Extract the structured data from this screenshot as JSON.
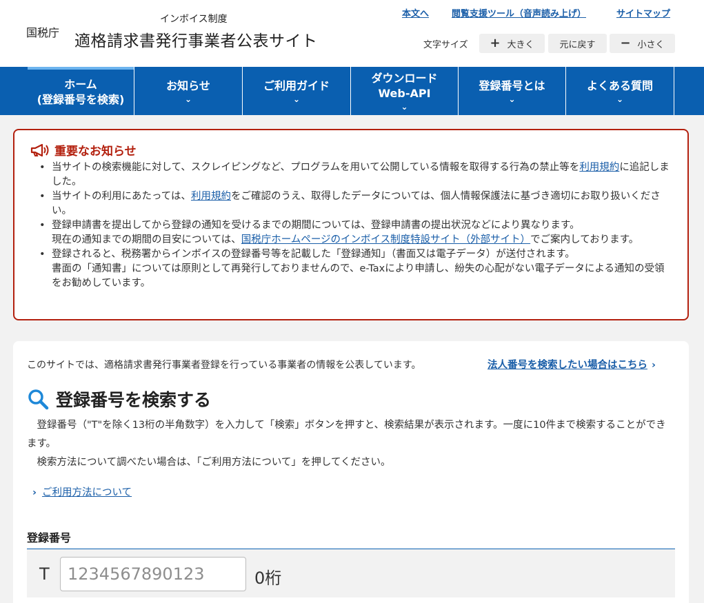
{
  "header": {
    "agency": "国税庁",
    "subtitle": "インボイス制度",
    "title": "適格請求書発行事業者公表サイト",
    "links": [
      "本文へ",
      "閲覧支援ツール（音声読み上げ）",
      "サイトマップ"
    ],
    "font_size_label": "文字サイズ",
    "font_buttons": [
      {
        "symbol": "+",
        "label": "大きく"
      },
      {
        "symbol": "",
        "label": "元に戻す"
      },
      {
        "symbol": "−",
        "label": "小さく"
      }
    ]
  },
  "nav": {
    "items": [
      {
        "line1": "ホーム",
        "line2": "(登録番号を検索)",
        "chevron": ""
      },
      {
        "line1": "お知らせ",
        "line2": "",
        "chevron": "⌄"
      },
      {
        "line1": "ご利用ガイド",
        "line2": "",
        "chevron": "⌄"
      },
      {
        "line1": "ダウンロード",
        "line2": "Web-API",
        "chevron": "⌄"
      },
      {
        "line1": "登録番号とは",
        "line2": "",
        "chevron": "⌄"
      },
      {
        "line1": "よくある質問",
        "line2": "",
        "chevron": "⌄"
      }
    ]
  },
  "notice": {
    "title": "重要なお知らせ",
    "items": [
      {
        "pre": "当サイトの検索機能に対して、スクレイピングなど、プログラムを用いて公開している情報を取得する行為の禁止等を",
        "link": "利用規約",
        "post": "に追記しました。"
      },
      {
        "pre": "当サイトの利用にあたっては、",
        "link": "利用規約",
        "post": "をご確認のうえ、取得したデータについては、個人情報保護法に基づき適切にお取り扱いください。"
      },
      {
        "pre": "登録申請書を提出してから登録の通知を受けるまでの期間については、登録申請書の提出状況などにより異なります。",
        "pre2": "現在の通知までの期間の目安については、",
        "link": "国税庁ホームページのインボイス制度特設サイト（外部サイト）",
        "post": "でご案内しております。"
      },
      {
        "pre": "登録されると、税務署からインボイスの登録番号等を記載した「登録通知」（書面又は電子データ）が送付されます。",
        "pre2": "書面の「通知書」については原則として再発行しておりませんので、e-Taxにより申請し、紛失の心配がない電子データによる通知の受領をお勧めしています。"
      }
    ]
  },
  "main": {
    "intro": "このサイトでは、適格請求書発行事業者登録を行っている事業者の情報を公表しています。",
    "corp_link": "法人番号を検索したい場合はこちら",
    "corp_arrow": "›",
    "search_title": "登録番号を検索する",
    "desc1": "登録番号（\"T\"を除く13桁の半角数字）を入力して「検索」ボタンを押すと、検索結果が表示されます。一度に10件まで検索することができます。",
    "desc2": "検索方法について調べたい場合は、「ご利用方法について」を押してください。",
    "howto_arrow": "›",
    "howto_link": "ご利用方法について",
    "reg_label": "登録番号",
    "t_prefix": "T",
    "input_placeholder": "1234567890123",
    "digit_count": "0桁"
  },
  "colors": {
    "nav_bg": "#0a5fb0",
    "notice_border": "#b3200e",
    "link": "#1a5ea8"
  }
}
